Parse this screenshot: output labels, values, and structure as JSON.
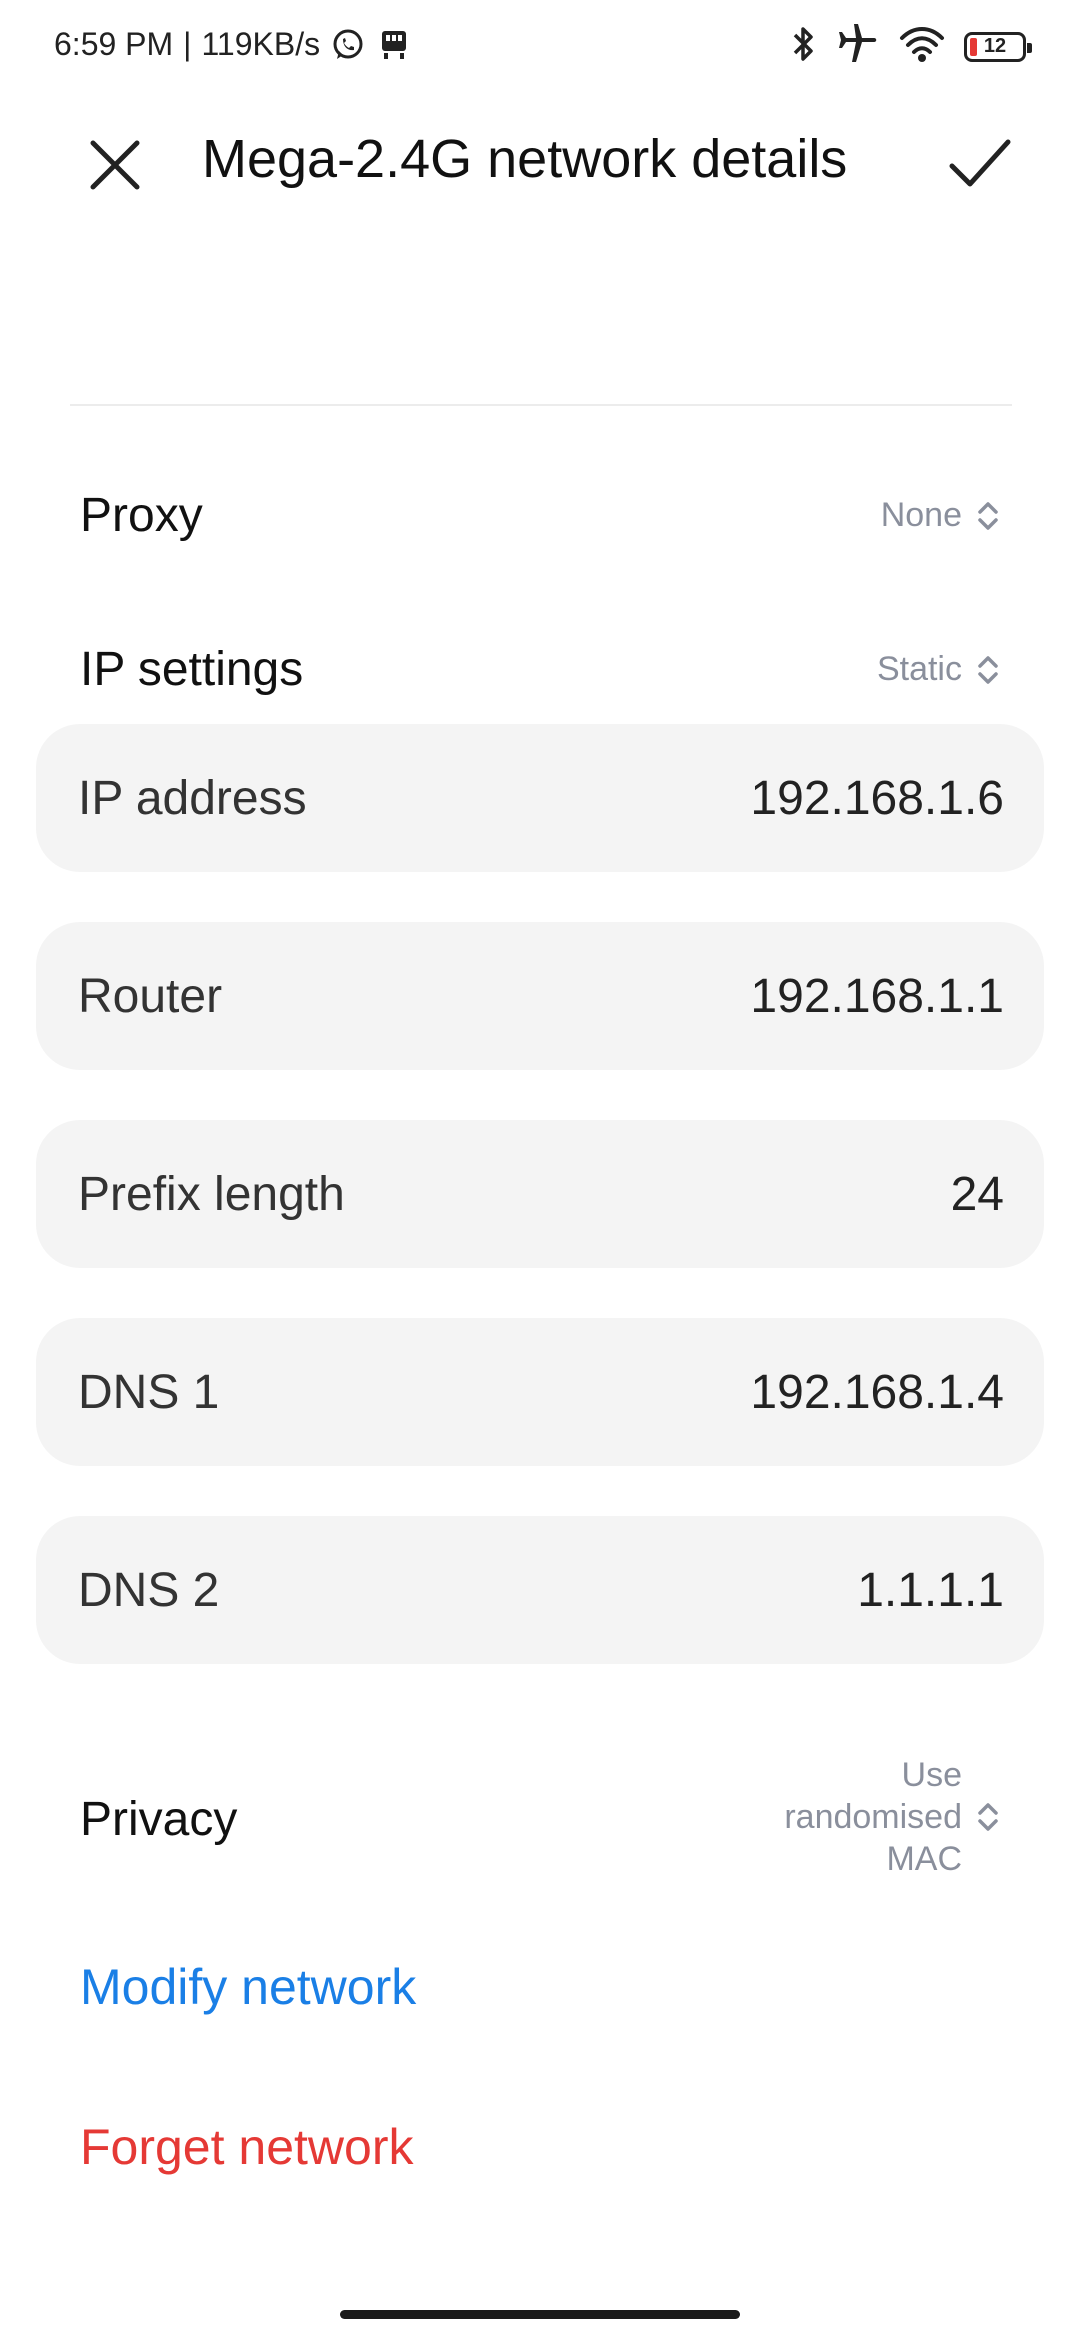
{
  "status_bar": {
    "time": "6:59 PM",
    "separator": "|",
    "speed": "119KB/s",
    "battery_level": "12",
    "icons": [
      "whatsapp-icon",
      "app-notification-icon",
      "bluetooth-icon",
      "airplane-mode-icon",
      "wifi-icon",
      "battery-icon"
    ],
    "battery_color": "#e53935"
  },
  "header": {
    "title": "Mega-2.4G network details",
    "close_icon": "close-icon",
    "confirm_icon": "checkmark-icon"
  },
  "proxy": {
    "label": "Proxy",
    "value": "None"
  },
  "ip_settings": {
    "label": "IP settings",
    "value": "Static"
  },
  "fields": [
    {
      "label": "IP address",
      "value": "192.168.1.6"
    },
    {
      "label": "Router",
      "value": "192.168.1.1"
    },
    {
      "label": "Prefix length",
      "value": "24"
    },
    {
      "label": "DNS 1",
      "value": "192.168.1.4"
    },
    {
      "label": "DNS 2",
      "value": "1.1.1.1"
    }
  ],
  "privacy": {
    "label": "Privacy",
    "value_lines": [
      "Use",
      "randomised",
      "MAC"
    ]
  },
  "actions": {
    "modify": "Modify network",
    "forget": "Forget network"
  },
  "colors": {
    "link_blue": "#1a7fe6",
    "danger_red": "#e53935",
    "muted_gray": "#8a8f9c",
    "card_bg": "#f4f4f4"
  }
}
